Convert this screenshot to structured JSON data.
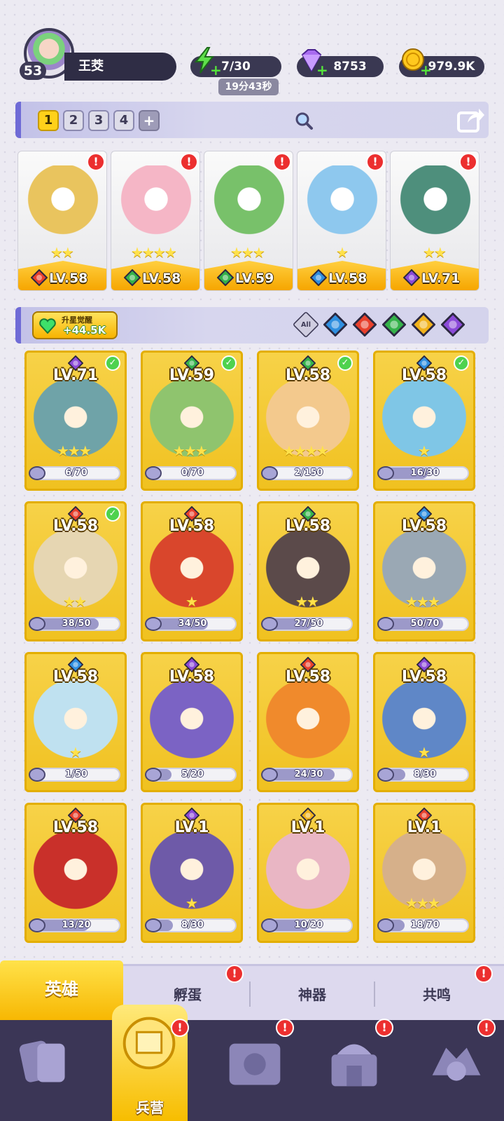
{
  "player": {
    "level": "53",
    "name": "王茭"
  },
  "resources": {
    "energy": "7/30",
    "energy_timer": "19分43秒",
    "gems": "8753",
    "gold": "979.9K"
  },
  "teams": {
    "tabs": [
      "1",
      "2",
      "3",
      "4"
    ],
    "add_label": "+",
    "active_index": 0
  },
  "lineup": [
    {
      "level": "LV.58",
      "element": "fire",
      "stars": 2,
      "alert": "!",
      "color": "#e9c45e"
    },
    {
      "level": "LV.58",
      "element": "nature",
      "stars": 4,
      "alert": "!",
      "color": "#f5b6c6"
    },
    {
      "level": "LV.59",
      "element": "nature",
      "stars": 3,
      "alert": "!",
      "color": "#78c16a"
    },
    {
      "level": "LV.58",
      "element": "water",
      "stars": 1,
      "alert": "!",
      "color": "#8ec8ee"
    },
    {
      "level": "LV.71",
      "element": "dark",
      "stars": 2,
      "alert": "!",
      "color": "#4e8f7c"
    }
  ],
  "awaken": {
    "title": "升星觉醒",
    "value": "+44.5K"
  },
  "filters": [
    "All",
    "water",
    "fire",
    "nature",
    "light",
    "dark"
  ],
  "filter_all_label": "All",
  "heroes": [
    {
      "level": "LV.71",
      "element": "dark",
      "checked": true,
      "progress": "6/70",
      "fill": 0.09,
      "stars": 3,
      "color": "#6fa3a8"
    },
    {
      "level": "LV.59",
      "element": "nature",
      "checked": true,
      "progress": "0/70",
      "fill": 0.0,
      "stars": 3,
      "color": "#8fc46e"
    },
    {
      "level": "LV.58",
      "element": "nature",
      "checked": true,
      "progress": "2/150",
      "fill": 0.01,
      "stars": 4,
      "color": "#f3c98d"
    },
    {
      "level": "LV.58",
      "element": "water",
      "checked": true,
      "progress": "16/30",
      "fill": 0.53,
      "stars": 1,
      "color": "#7fc6e6"
    },
    {
      "level": "LV.58",
      "element": "fire",
      "checked": true,
      "progress": "38/50",
      "fill": 0.76,
      "stars": 2,
      "color": "#e6d6b2"
    },
    {
      "level": "LV.58",
      "element": "fire",
      "checked": false,
      "progress": "34/50",
      "fill": 0.68,
      "stars": 1,
      "color": "#d9462c"
    },
    {
      "level": "LV.58",
      "element": "nature",
      "checked": false,
      "progress": "27/50",
      "fill": 0.54,
      "stars": 2,
      "color": "#5b4a4a"
    },
    {
      "level": "LV.58",
      "element": "water",
      "checked": false,
      "progress": "50/70",
      "fill": 0.71,
      "stars": 3,
      "color": "#9aa8b4"
    },
    {
      "level": "LV.58",
      "element": "water",
      "checked": false,
      "progress": "1/50",
      "fill": 0.02,
      "stars": 1,
      "color": "#bfe1f0"
    },
    {
      "level": "LV.58",
      "element": "dark",
      "checked": false,
      "progress": "5/20",
      "fill": 0.25,
      "stars": 0,
      "color": "#7b63c4"
    },
    {
      "level": "LV.58",
      "element": "fire",
      "checked": false,
      "progress": "24/30",
      "fill": 0.8,
      "stars": 0,
      "color": "#f08a2c"
    },
    {
      "level": "LV.58",
      "element": "dark",
      "checked": false,
      "progress": "8/30",
      "fill": 0.27,
      "stars": 1,
      "color": "#5f87c7"
    },
    {
      "level": "LV.58",
      "element": "fire",
      "checked": false,
      "progress": "13/20",
      "fill": 0.65,
      "stars": 0,
      "color": "#c9302a"
    },
    {
      "level": "LV.1",
      "element": "dark",
      "checked": false,
      "progress": "8/30",
      "fill": 0.27,
      "stars": 1,
      "color": "#6e5aa8"
    },
    {
      "level": "LV.1",
      "element": "light",
      "checked": false,
      "progress": "10/20",
      "fill": 0.5,
      "stars": 0,
      "color": "#e9b6c4"
    },
    {
      "level": "LV.1",
      "element": "fire",
      "checked": false,
      "progress": "18/70",
      "fill": 0.26,
      "stars": 3,
      "color": "#d6b08a"
    }
  ],
  "subtabs": [
    {
      "label": "英雄",
      "alert": false
    },
    {
      "label": "孵蛋",
      "alert": true
    },
    {
      "label": "神器",
      "alert": false
    },
    {
      "label": "共鸣",
      "alert": true
    }
  ],
  "nav": [
    {
      "label": "",
      "icon": "cards-icon",
      "alert": false
    },
    {
      "label": "兵营",
      "icon": "barracks-icon",
      "alert": true
    },
    {
      "label": "",
      "icon": "map-icon",
      "alert": true
    },
    {
      "label": "",
      "icon": "shop-icon",
      "alert": true
    },
    {
      "label": "",
      "icon": "guild-icon",
      "alert": true
    }
  ],
  "colors": {
    "fire": "#e8402c",
    "water": "#2f8fe0",
    "nature": "#35b24a",
    "light": "#f1b21c",
    "dark": "#8b4ad8",
    "accent": "#ffd11a"
  }
}
